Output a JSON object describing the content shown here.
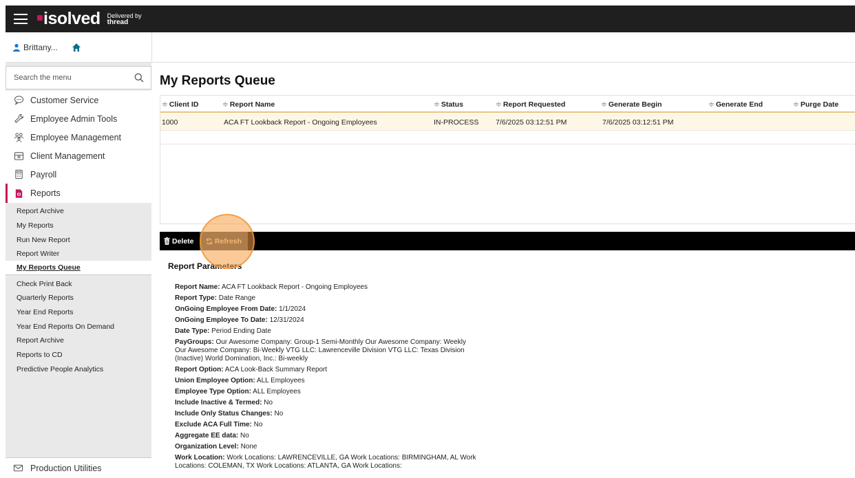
{
  "brand": {
    "logo": "isolved",
    "delivered_by": "Delivered by",
    "delivered_name": "thread",
    "accent": "#c2185b"
  },
  "user": {
    "name": "Brittany..."
  },
  "search": {
    "placeholder": "Search the menu"
  },
  "menu": [
    {
      "label": "Customer Service",
      "icon": "chat-icon"
    },
    {
      "label": "Employee Admin Tools",
      "icon": "wrench-icon"
    },
    {
      "label": "Employee Management",
      "icon": "people-icon"
    },
    {
      "label": "Client Management",
      "icon": "building-icon"
    },
    {
      "label": "Payroll",
      "icon": "calculator-icon"
    },
    {
      "label": "Reports",
      "icon": "report-icon"
    }
  ],
  "submenu": [
    "Report Archive",
    "My Reports",
    "Run New Report",
    "Report Writer",
    "My Reports Queue",
    "Check Print Back",
    "Quarterly Reports",
    "Year End Reports",
    "Year End Reports On Demand",
    "Report Archive",
    "Reports to CD",
    "Predictive People Analytics"
  ],
  "bottom_menu": {
    "label": "Production Utilities",
    "icon": "envelope-icon"
  },
  "page_title": "My Reports Queue",
  "table": {
    "sort_glyph": "≑",
    "columns": [
      "Client ID",
      "Report Name",
      "Status",
      "Report Requested",
      "Generate Begin",
      "Generate End",
      "Purge Date"
    ],
    "rows": [
      [
        "1000",
        "ACA FT Lookback Report - Ongoing Employees",
        "IN-PROCESS",
        "7/6/2025 03:12:51 PM",
        "7/6/2025 03:12:51 PM",
        "",
        ""
      ]
    ]
  },
  "toolbar": {
    "delete_label": "Delete",
    "refresh_label": "Refresh"
  },
  "parameters": {
    "title": "Report Parameters",
    "items": [
      {
        "label": "Report Name:",
        "value": "ACA FT Lookback Report - Ongoing Employees"
      },
      {
        "label": "Report Type:",
        "value": "Date Range"
      },
      {
        "label": "OnGoing Employee From Date:",
        "value": "1/1/2024"
      },
      {
        "label": "OnGoing Employee To Date:",
        "value": "12/31/2024"
      },
      {
        "label": "Date Type:",
        "value": "Period Ending Date"
      },
      {
        "label": "PayGroups:",
        "value": "Our Awesome Company: Group-1 Semi-Monthly Our Awesome Company: Weekly Our Awesome Company: Bi-Weekly VTG LLC: Lawrenceville Division VTG LLC: Texas Division (Inactive) World Domination, Inc.: Bi-weekly"
      },
      {
        "label": "Report Option:",
        "value": "ACA Look-Back Summary Report"
      },
      {
        "label": "Union Employee Option:",
        "value": "ALL Employees"
      },
      {
        "label": "Employee Type Option:",
        "value": "ALL Employees"
      },
      {
        "label": "Include Inactive & Termed:",
        "value": "No"
      },
      {
        "label": "Include Only Status Changes:",
        "value": "No"
      },
      {
        "label": "Exclude ACA Full Time:",
        "value": "No"
      },
      {
        "label": "Aggregate EE data:",
        "value": "No"
      },
      {
        "label": "Organization Level:",
        "value": "None"
      },
      {
        "label": "Work Location:",
        "value": "Work Locations: LAWRENCEVILLE, GA Work Locations: BIRMINGHAM, AL Work Locations: COLEMAN, TX Work Locations: ATLANTA, GA Work Locations:"
      }
    ]
  }
}
